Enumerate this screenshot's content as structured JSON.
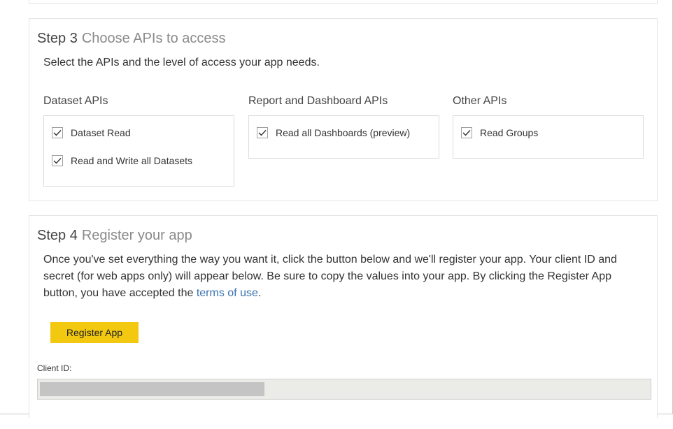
{
  "step3": {
    "step_number": "Step 3",
    "step_title": "Choose APIs to access",
    "description": "Select the APIs and the level of access your app needs.",
    "groups": [
      {
        "title": "Dataset APIs",
        "options": [
          {
            "label": "Dataset Read",
            "checked": true
          },
          {
            "label": "Read and Write all Datasets",
            "checked": true
          }
        ]
      },
      {
        "title": "Report and Dashboard APIs",
        "options": [
          {
            "label": "Read all Dashboards (preview)",
            "checked": true
          }
        ]
      },
      {
        "title": "Other APIs",
        "options": [
          {
            "label": "Read Groups",
            "checked": true
          }
        ]
      }
    ]
  },
  "step4": {
    "step_number": "Step 4",
    "step_title": "Register your app",
    "description_before_link": "Once you've set everything the way you want it, click the button below and we'll register your app. Your client ID and secret (for web apps only) will appear below. Be sure to copy the values into your app. By clicking the Register App button, you have accepted the ",
    "terms_link": "terms of use",
    "description_after_link": ".",
    "register_button_label": "Register App",
    "client_id_label": "Client ID:",
    "client_id_value": ""
  },
  "colors": {
    "accent_button": "#f2c811",
    "link": "#3a73b0"
  }
}
